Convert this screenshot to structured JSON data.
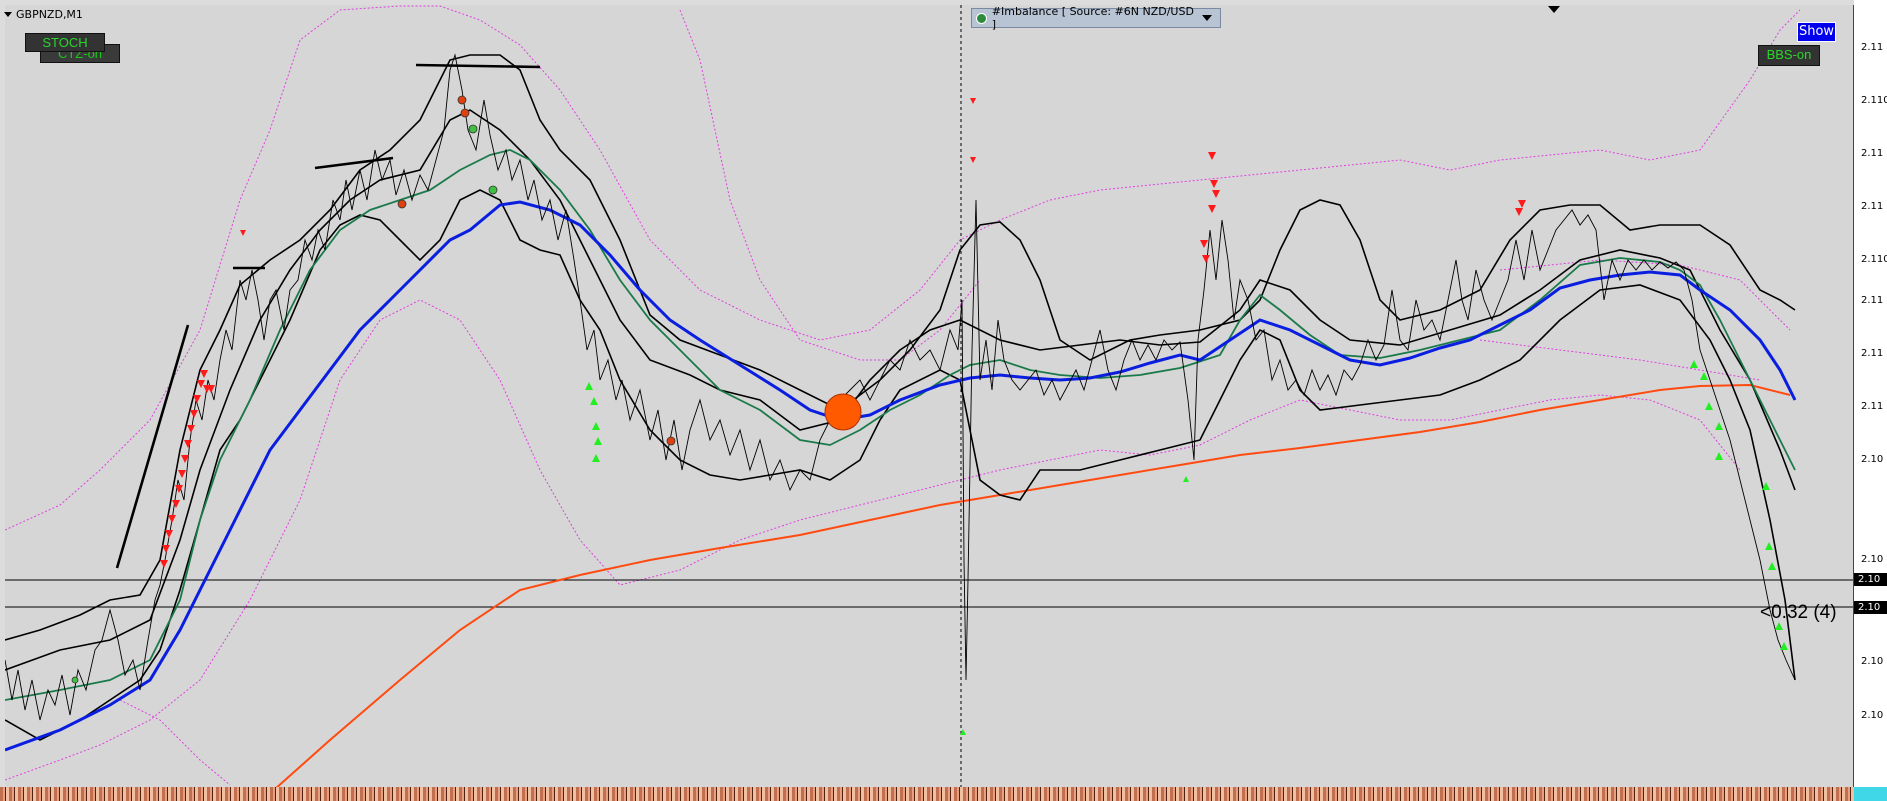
{
  "window": {
    "title": "GBPNZD,M1"
  },
  "buttons": {
    "stoch": "STOCH",
    "ctz": "CTZ-on",
    "bbs": "BBS-on",
    "show": "Show"
  },
  "imbalance": {
    "label": "#Imbalance [ Source: #6N NZD/USD ]"
  },
  "price_axis": {
    "ticks": [
      "2.11",
      "2.110",
      "2.11",
      "2.11",
      "2.110",
      "2.11",
      "2.11",
      "2.11",
      "2.10",
      "2.10",
      "2.10",
      "2.10"
    ],
    "tag_upper": "2.10",
    "tag_lower": "2.10"
  },
  "lot_label": "<0.32 (4)",
  "colors": {
    "background": "#d6d6d6",
    "price_line": "#000000",
    "ma_fast": "#1a7a4a",
    "ma_blue": "#0a1ee0",
    "ma_slow": "#ff4a10",
    "envelope": "#e040e0",
    "sell_arrow": "#ff1a1a",
    "buy_arrow": "#22ee22",
    "big_dot": "#ff5a00"
  }
}
